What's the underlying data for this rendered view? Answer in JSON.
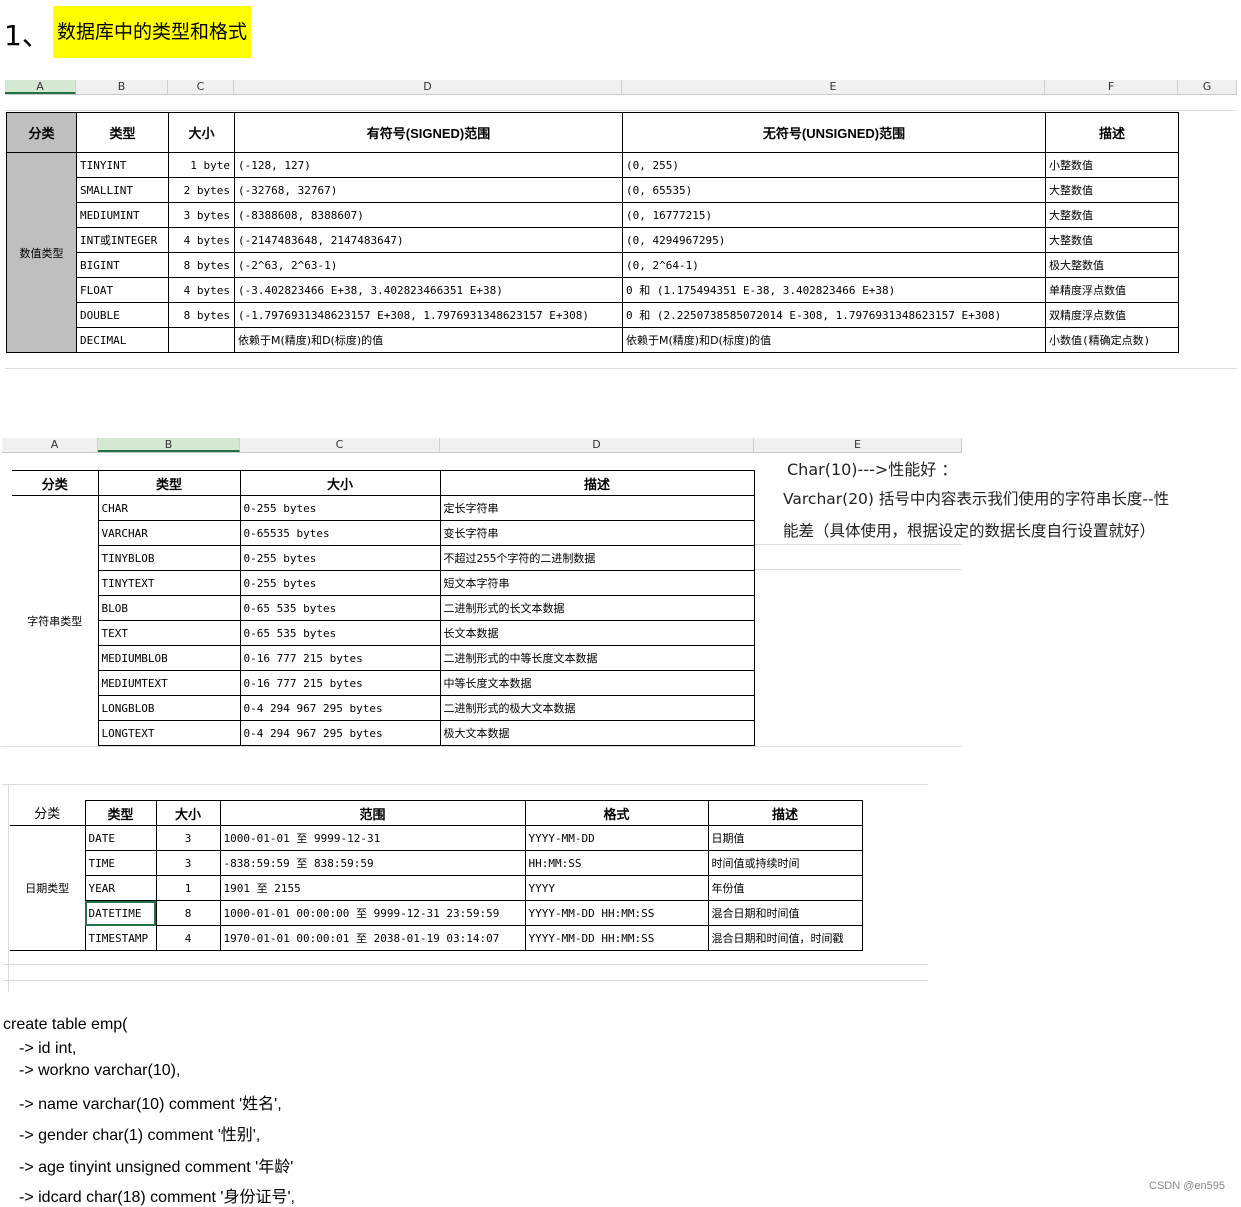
{
  "heading": {
    "number": "1、",
    "text": "数据库中的类型和格式"
  },
  "numeric": {
    "columns": [
      "A",
      "B",
      "C",
      "D",
      "E",
      "F",
      "G"
    ],
    "headers": [
      "分类",
      "类型",
      "大小",
      "有符号(SIGNED)范围",
      "无符号(UNSIGNED)范围",
      "描述"
    ],
    "category": "数值类型",
    "rows": [
      [
        "TINYINT",
        "1 byte",
        "(-128, 127)",
        "(0, 255)",
        "小整数值"
      ],
      [
        "SMALLINT",
        "2 bytes",
        "(-32768, 32767)",
        "(0, 65535)",
        "大整数值"
      ],
      [
        "MEDIUMINT",
        "3 bytes",
        "(-8388608, 8388607)",
        "(0, 16777215)",
        "大整数值"
      ],
      [
        "INT或INTEGER",
        "4 bytes",
        "(-2147483648, 2147483647)",
        "(0, 4294967295)",
        "大整数值"
      ],
      [
        "BIGINT",
        "8 bytes",
        "(-2^63, 2^63-1)",
        "(0, 2^64-1)",
        "极大整数值"
      ],
      [
        "FLOAT",
        "4 bytes",
        "(-3.402823466 E+38, 3.402823466351 E+38)",
        "0 和 (1.175494351 E-38, 3.402823466 E+38)",
        "单精度浮点数值"
      ],
      [
        "DOUBLE",
        "8 bytes",
        "(-1.7976931348623157 E+308, 1.7976931348623157 E+308)",
        "0 和 (2.2250738585072014 E-308, 1.7976931348623157 E+308)",
        "双精度浮点数值"
      ],
      [
        "DECIMAL",
        "",
        "依赖于M(精度)和D(标度)的值",
        "依赖于M(精度)和D(标度)的值",
        "小数值(精确定点数)"
      ]
    ]
  },
  "string": {
    "columns": [
      "A",
      "B",
      "C",
      "D",
      "E"
    ],
    "headers": [
      "分类",
      "类型",
      "大小",
      "描述"
    ],
    "category": "字符串类型",
    "rows": [
      [
        "CHAR",
        "0-255 bytes",
        "定长字符串"
      ],
      [
        "VARCHAR",
        "0-65535 bytes",
        "变长字符串"
      ],
      [
        "TINYBLOB",
        "0-255 bytes",
        "不超过255个字符的二进制数据"
      ],
      [
        "TINYTEXT",
        "0-255 bytes",
        "短文本字符串"
      ],
      [
        "BLOB",
        "0-65 535 bytes",
        "二进制形式的长文本数据"
      ],
      [
        "TEXT",
        "0-65 535 bytes",
        "长文本数据"
      ],
      [
        "MEDIUMBLOB",
        "0-16 777 215 bytes",
        "二进制形式的中等长度文本数据"
      ],
      [
        "MEDIUMTEXT",
        "0-16 777 215 bytes",
        "中等长度文本数据"
      ],
      [
        "LONGBLOB",
        "0-4 294 967 295 bytes",
        "二进制形式的极大文本数据"
      ],
      [
        "LONGTEXT",
        "0-4 294 967 295 bytes",
        "极大文本数据"
      ]
    ],
    "note_lines": [
      "Char(10)--->性能好  ：",
      "Varchar(20) 括号中内容表示我们使用的字符串长度--性",
      "能差（具体使用，根据设定的数据长度自行设置就好）"
    ]
  },
  "date": {
    "headers": [
      "分类",
      "类型",
      "大小",
      "范围",
      "格式",
      "描述"
    ],
    "category": "日期类型",
    "rows": [
      [
        "DATE",
        "3",
        "1000-01-01 至 9999-12-31",
        "YYYY-MM-DD",
        "日期值"
      ],
      [
        "TIME",
        "3",
        "-838:59:59 至 838:59:59",
        "HH:MM:SS",
        "时间值或持续时间"
      ],
      [
        "YEAR",
        "1",
        "1901 至 2155",
        "YYYY",
        "年份值"
      ],
      [
        "DATETIME",
        "8",
        "1000-01-01 00:00:00 至 9999-12-31 23:59:59",
        "YYYY-MM-DD HH:MM:SS",
        "混合日期和时间值"
      ],
      [
        "TIMESTAMP",
        "4",
        "1970-01-01 00:00:01 至 2038-01-19 03:14:07",
        "YYYY-MM-DD HH:MM:SS",
        "混合日期和时间值，时间戳"
      ]
    ]
  },
  "code_lines": [
    "create table emp(",
    "    -> id int,",
    "    -> workno varchar(10),",
    "    -> name varchar(10) comment '姓名',",
    "    -> gender char(1)  comment '性别',",
    "    -> age tinyint unsigned comment '年龄'",
    "    -> idcard char(18) comment '身份证号',"
  ],
  "watermark": "CSDN @en595"
}
